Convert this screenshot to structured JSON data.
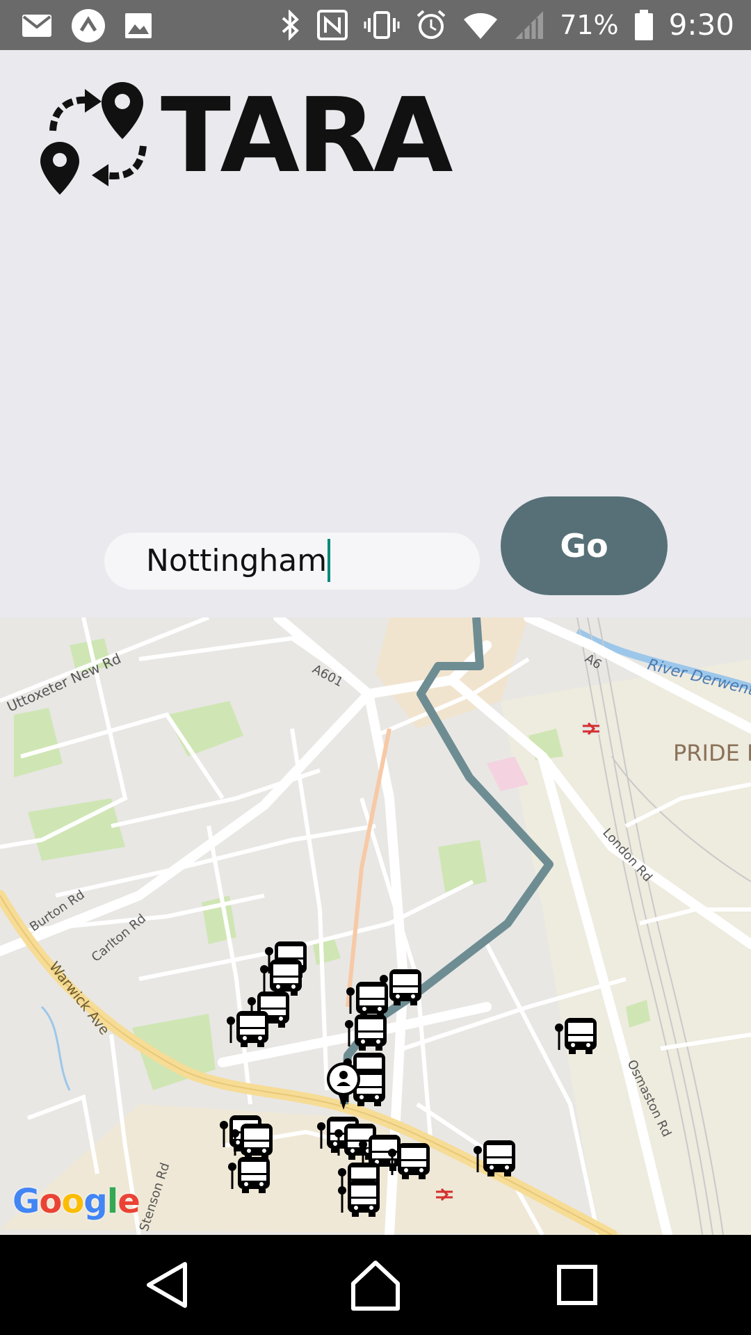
{
  "status_bar": {
    "battery": "71%",
    "time": "9:30",
    "left_icons": [
      "gmail-icon",
      "arrow-app-icon",
      "gallery-icon"
    ],
    "right_icons": [
      "bluetooth-icon",
      "nfc-icon",
      "vibrate-icon",
      "alarm-icon",
      "wifi-icon",
      "signal-icon",
      "battery-icon"
    ]
  },
  "app": {
    "logo_text": "TARA"
  },
  "search": {
    "value": "Nottingham",
    "button_label": "Go"
  },
  "map": {
    "labels": {
      "uttoxeter": "Uttoxeter New Rd",
      "a601": "A601",
      "a6": "A6",
      "river": "River Derwent",
      "pride": "PRIDE P",
      "london_rd": "London Rd",
      "burton_rd": "Burton Rd",
      "carlton_rd": "Carlton Rd",
      "warwick": "Warwick Ave",
      "osmaston": "Osmaston Rd",
      "stenson": "Stenson Rd"
    },
    "attribution": "Google",
    "colors": {
      "route": "#6e8d93",
      "park": "#cfe6b4",
      "road": "#ffffff",
      "major_road": "#f6dc95",
      "water": "#9cc7ea"
    }
  },
  "nav": {
    "icons": [
      "back-icon",
      "home-icon",
      "recents-icon"
    ]
  }
}
